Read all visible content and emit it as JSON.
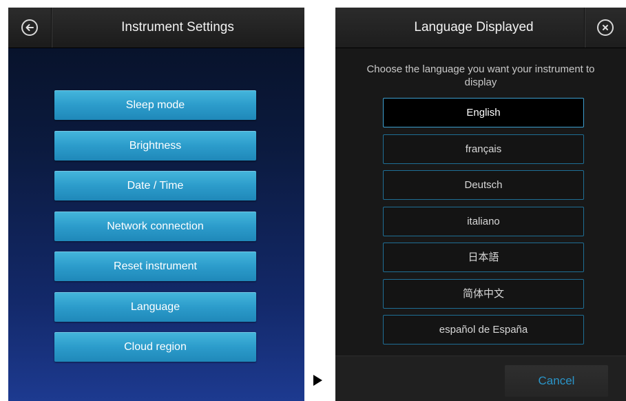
{
  "settings": {
    "title": "Instrument Settings",
    "back_icon": "back-arrow-icon",
    "items": [
      {
        "label": "Sleep mode"
      },
      {
        "label": "Brightness"
      },
      {
        "label": "Date / Time"
      },
      {
        "label": "Network connection"
      },
      {
        "label": "Reset instrument"
      },
      {
        "label": "Language"
      },
      {
        "label": "Cloud region"
      }
    ],
    "accent": "#2c9ccb"
  },
  "language_dialog": {
    "title": "Language Displayed",
    "close_icon": "close-icon",
    "prompt": "Choose the language you want your instrument to display",
    "options": [
      {
        "label": "English",
        "selected": true
      },
      {
        "label": "français",
        "selected": false
      },
      {
        "label": "Deutsch",
        "selected": false
      },
      {
        "label": "italiano",
        "selected": false
      },
      {
        "label": "日本語",
        "selected": false
      },
      {
        "label": "简体中文",
        "selected": false
      },
      {
        "label": "español de España",
        "selected": false
      }
    ],
    "cancel_label": "Cancel",
    "cancel_color": "#2a94c8"
  },
  "transition_icon": "right-triangle-arrow-icon"
}
